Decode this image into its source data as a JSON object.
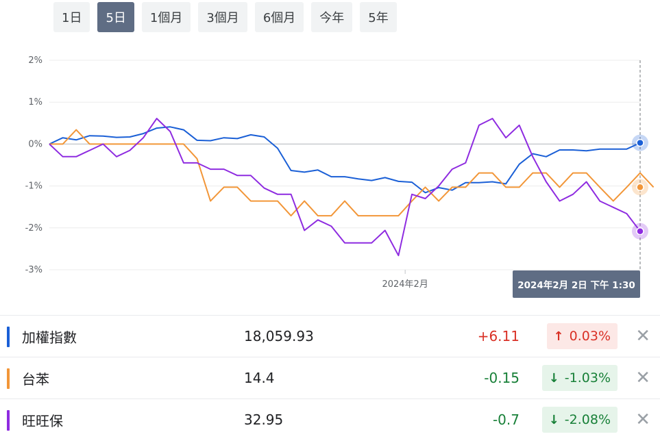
{
  "range_tabs": [
    {
      "label": "1日",
      "active": false
    },
    {
      "label": "5日",
      "active": true
    },
    {
      "label": "1個月",
      "active": false
    },
    {
      "label": "3個月",
      "active": false
    },
    {
      "label": "6個月",
      "active": false
    },
    {
      "label": "今年",
      "active": false
    },
    {
      "label": "5年",
      "active": false
    }
  ],
  "tooltip": "2024年2月 2日 下午 1:30",
  "chart_data": {
    "type": "line",
    "yticks": [
      2,
      1,
      0,
      -1,
      -2,
      -3
    ],
    "ytick_labels": [
      "2%",
      "1%",
      "0%",
      "-1%",
      "-2%",
      "-3%"
    ],
    "ylim": [
      -3,
      2
    ],
    "x_tick": {
      "index": 26.5,
      "label": "2024年2月"
    },
    "n_points": 45,
    "grid": true,
    "series": [
      {
        "name": "加權指數",
        "color": "#1a5fd6",
        "values": [
          0,
          0.15,
          0.1,
          0.2,
          0.19,
          0.16,
          0.17,
          0.25,
          0.38,
          0.41,
          0.34,
          0.09,
          0.08,
          0.15,
          0.13,
          0.22,
          0.17,
          -0.1,
          -0.63,
          -0.67,
          -0.62,
          -0.78,
          -0.78,
          -0.83,
          -0.87,
          -0.8,
          -0.89,
          -0.91,
          -1.16,
          -1.04,
          -1.1,
          -0.92,
          -0.92,
          -0.9,
          -0.95,
          -0.48,
          -0.23,
          -0.3,
          -0.14,
          -0.14,
          -0.16,
          -0.12,
          -0.12,
          -0.12,
          0.03
        ]
      },
      {
        "name": "台苯",
        "color": "#f29638",
        "values": [
          0,
          0,
          0.34,
          0,
          0,
          0,
          0,
          0,
          0,
          0,
          0,
          -0.35,
          -1.36,
          -1.03,
          -1.03,
          -1.36,
          -1.36,
          -1.36,
          -1.71,
          -1.36,
          -1.71,
          -1.71,
          -1.36,
          -1.71,
          -1.71,
          -1.71,
          -1.71,
          -1.36,
          -1.03,
          -1.36,
          -1.03,
          -1.03,
          -0.69,
          -0.69,
          -1.03,
          -1.03,
          -0.69,
          -0.69,
          -1.03,
          -0.69,
          -0.69,
          -1.03,
          -1.36,
          -1.03,
          -0.69,
          -1.03
        ]
      },
      {
        "name": "旺旺保",
        "color": "#8e2be0",
        "values": [
          0,
          -0.3,
          -0.3,
          -0.15,
          0,
          -0.3,
          -0.15,
          0.15,
          0.61,
          0.3,
          -0.45,
          -0.45,
          -0.6,
          -0.6,
          -0.75,
          -0.75,
          -1.05,
          -1.2,
          -1.2,
          -2.06,
          -1.81,
          -1.96,
          -2.36,
          -2.36,
          -2.36,
          -2.06,
          -2.66,
          -1.2,
          -1.3,
          -1.0,
          -0.6,
          -0.45,
          0.45,
          0.61,
          0.15,
          0.45,
          -0.3,
          -0.9,
          -1.36,
          -1.2,
          -0.9,
          -1.36,
          -1.51,
          -1.66,
          -2.08
        ]
      }
    ]
  },
  "rows": [
    {
      "name": "加權指數",
      "color": "#1a5fd6",
      "value": "18,059.93",
      "change": "+6.11",
      "pct": "0.03%",
      "arrow": "↑",
      "dir": "up"
    },
    {
      "name": "台苯",
      "color": "#f29638",
      "value": "14.4",
      "change": "-0.15",
      "pct": "-1.03%",
      "arrow": "↓",
      "dir": "down"
    },
    {
      "name": "旺旺保",
      "color": "#8e2be0",
      "value": "32.95",
      "change": "-0.7",
      "pct": "-2.08%",
      "arrow": "↓",
      "dir": "down"
    }
  ],
  "remove_icon": "close-icon"
}
